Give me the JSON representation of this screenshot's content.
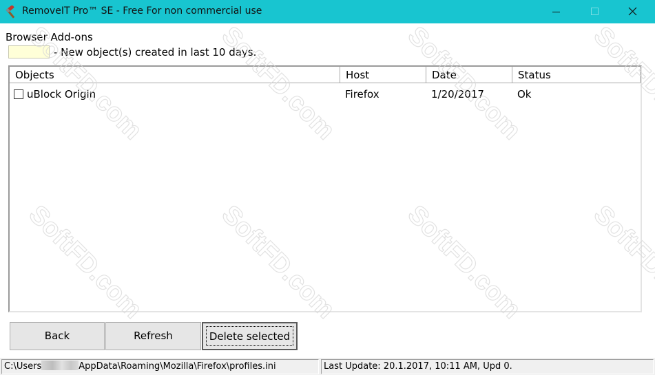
{
  "window": {
    "title": "RemoveIT Pro™ SE - Free For non commercial use",
    "titlebar_color": "#18c5d0"
  },
  "icons": {
    "app": "hammer-icon",
    "minimize": "minimize-icon",
    "maximize": "maximize-icon",
    "close": "close-icon"
  },
  "section": {
    "title": "Browser Add-ons",
    "legend_text": "- New object(s) created in last 10 days.",
    "legend_color": "#ffffd8"
  },
  "table": {
    "columns": [
      "Objects",
      "Host",
      "Date",
      "Status"
    ],
    "rows": [
      {
        "object": "uBlock Origin",
        "host": "Firefox",
        "date": "1/20/2017",
        "status": "Ok",
        "checked": false
      }
    ]
  },
  "buttons": {
    "back": "Back",
    "refresh": "Refresh",
    "delete_selected": "Delete selected"
  },
  "statusbar": {
    "path_prefix": "C:\\Users",
    "path_suffix": "AppData\\Roaming\\Mozilla\\Firefox\\profiles.ini",
    "last_update": "Last Update: 20.1.2017, 10:11 AM, Upd 0."
  },
  "watermark": {
    "text": "SoftFD.com"
  }
}
